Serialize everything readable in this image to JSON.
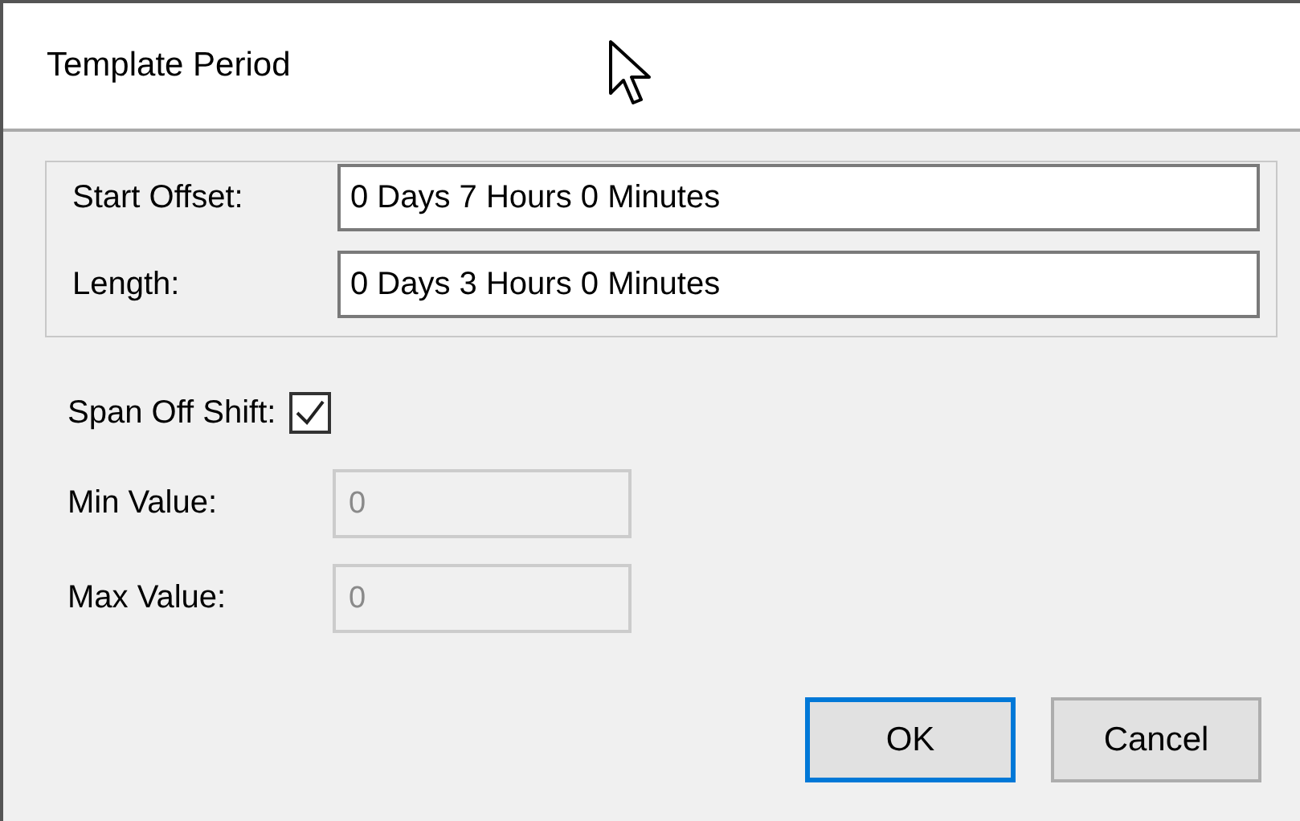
{
  "window": {
    "title": "Template Period"
  },
  "fields": [
    {
      "label": "Start Offset:",
      "value": "0 Days 7 Hours 0 Minutes"
    },
    {
      "label": "Length:",
      "value": "0 Days 3 Hours 0 Minutes"
    }
  ],
  "span_off_shift": {
    "label": "Span Off Shift:",
    "checked": true
  },
  "limits": [
    {
      "label": "Min Value:",
      "value": "0",
      "disabled": true
    },
    {
      "label": "Max Value:",
      "value": "0",
      "disabled": true
    }
  ],
  "buttons": [
    {
      "label": "OK",
      "default": true
    },
    {
      "label": "Cancel",
      "default": false
    }
  ]
}
